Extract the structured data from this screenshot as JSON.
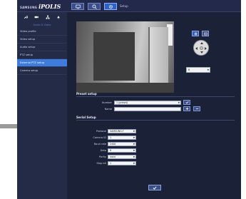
{
  "logo": {
    "brand": "SAMSUNG",
    "product": "iPOLIS"
  },
  "header": {
    "title": "Setup",
    "buttons": [
      {
        "icon": "monitor-icon"
      },
      {
        "icon": "search-icon"
      },
      {
        "icon": "gear-icon"
      }
    ]
  },
  "sidebar": {
    "tools": [
      {
        "icon": "wrench-icon"
      },
      {
        "icon": "camera-icon"
      },
      {
        "icon": "network-icon"
      },
      {
        "icon": "event-icon"
      }
    ],
    "section": "Audio & Video",
    "items": [
      {
        "label": "Video profile"
      },
      {
        "label": "Video setup"
      },
      {
        "label": "Audio setup"
      },
      {
        "label": "PTZ setup"
      },
      {
        "label": "External PTZ setup",
        "active": true
      },
      {
        "label": "Camera setup"
      }
    ]
  },
  "ptz": {
    "buttons": [
      {
        "icon": "ptz-icon"
      },
      {
        "icon": "zoom-icon"
      }
    ],
    "select_value": "8"
  },
  "preset": {
    "title": "Preset setup",
    "number_label": "Number",
    "number_value": "1 (preset)",
    "name_label": "Name",
    "name_value": ""
  },
  "serial": {
    "title": "Serial Setup",
    "fields": [
      {
        "label": "Protocol",
        "value": "SAMSUNG-T"
      },
      {
        "label": "Camera ID",
        "value": "1"
      },
      {
        "label": "Baud rate",
        "value": "2400"
      },
      {
        "label": "Data",
        "value": "8"
      },
      {
        "label": "Parity",
        "value": "none"
      },
      {
        "label": "Stop bit",
        "value": "1"
      }
    ]
  },
  "colors": {
    "background": "#1b2238",
    "sidebar": "#232b46",
    "active": "#3e7cde",
    "section": "#5d7bd2"
  }
}
